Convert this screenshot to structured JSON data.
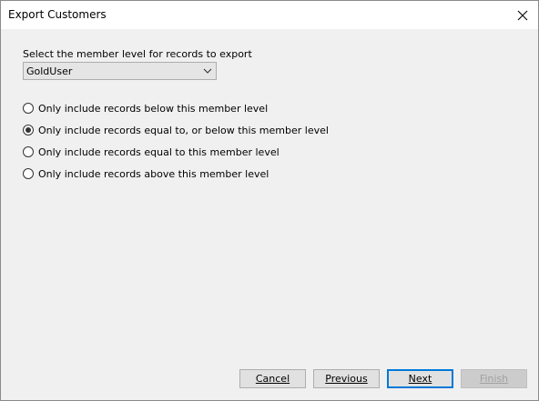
{
  "window": {
    "title": "Export Customers"
  },
  "level": {
    "prompt": "Select the member level for records to export",
    "selected": "GoldUser"
  },
  "options": [
    {
      "label": "Only include records below this member level",
      "checked": false
    },
    {
      "label": "Only include records equal to, or below this member level",
      "checked": true
    },
    {
      "label": "Only include records equal to this member level",
      "checked": false
    },
    {
      "label": "Only include records above this member level",
      "checked": false
    }
  ],
  "buttons": {
    "cancel": "Cancel",
    "previous": "Previous",
    "next": "Next",
    "finish": "Finish"
  },
  "icons": {
    "close": "close-icon",
    "dropdown": "chevron-down-icon"
  },
  "colors": {
    "accent": "#0078d7",
    "window_bg": "#f0f0f0"
  }
}
